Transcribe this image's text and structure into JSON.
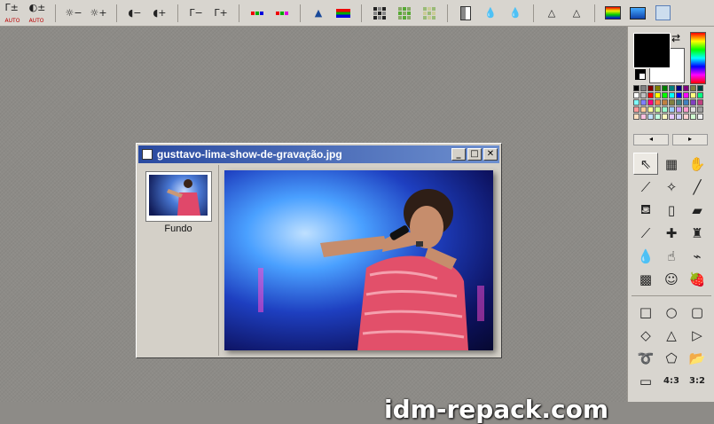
{
  "window": {
    "title": "gusttavo-lima-show-de-gravação.jpg",
    "buttons": {
      "minimize": "_",
      "maximize": "□",
      "close": "✕"
    }
  },
  "layers": [
    {
      "name": "Fundo"
    }
  ],
  "toolbar": {
    "auto_labels": [
      "AUTO",
      "AUTO"
    ],
    "glyphs": {
      "gamma": "Γ±",
      "contrast": "◐±",
      "bright_minus": "☼−",
      "bright_plus": "☼+",
      "half_minus": "◖−",
      "half_plus": "◖+",
      "gamma_minus": "Γ−",
      "gamma_plus": "Γ+",
      "hist": "▲",
      "drop": "💧",
      "tri": "△"
    }
  },
  "palette_nav": {
    "prev": "◂",
    "next": "▸"
  },
  "tool_icons": [
    {
      "name": "selection-arrow-icon",
      "glyph": "⇖"
    },
    {
      "name": "image-select-icon",
      "glyph": "▦"
    },
    {
      "name": "hand-pan-icon",
      "glyph": "✋"
    },
    {
      "name": "eyedropper-icon",
      "glyph": "⟋"
    },
    {
      "name": "magic-wand-icon",
      "glyph": "✧"
    },
    {
      "name": "line-tool-icon",
      "glyph": "╱"
    },
    {
      "name": "fill-bucket-icon",
      "glyph": "⛾"
    },
    {
      "name": "spray-can-icon",
      "glyph": "▯"
    },
    {
      "name": "eraser-icon",
      "glyph": "▰"
    },
    {
      "name": "brush-icon",
      "glyph": "⟋"
    },
    {
      "name": "brush-plus-icon",
      "glyph": "✚"
    },
    {
      "name": "stamp-icon",
      "glyph": "♜"
    },
    {
      "name": "water-drop-icon",
      "glyph": "💧"
    },
    {
      "name": "smudge-icon",
      "glyph": "☝"
    },
    {
      "name": "color-replace-icon",
      "glyph": "⌁"
    },
    {
      "name": "warp-grid-icon",
      "glyph": "▩"
    },
    {
      "name": "portrait-icon",
      "glyph": "☺"
    },
    {
      "name": "strawberry-icon",
      "glyph": "🍓"
    }
  ],
  "shape_icons": [
    {
      "name": "rectangle-icon",
      "glyph": "□"
    },
    {
      "name": "ellipse-icon",
      "glyph": "○"
    },
    {
      "name": "rounded-rectangle-icon",
      "glyph": "▢"
    },
    {
      "name": "diamond-icon",
      "glyph": "◇"
    },
    {
      "name": "triangle-icon",
      "glyph": "△"
    },
    {
      "name": "triangle-right-icon",
      "glyph": "▷"
    },
    {
      "name": "lasso-icon",
      "glyph": "➰"
    },
    {
      "name": "polygon-lasso-icon",
      "glyph": "⬠"
    },
    {
      "name": "open-folder-icon",
      "glyph": "📂"
    },
    {
      "name": "aspect-free-icon",
      "glyph": "▭"
    },
    {
      "name": "aspect-4-3-icon",
      "glyph": "4:3"
    },
    {
      "name": "aspect-3-2-icon",
      "glyph": "3:2"
    }
  ],
  "colors": {
    "foreground": "#000000",
    "background": "#ffffff",
    "palette": [
      "#000000",
      "#7f7f7f",
      "#7f0000",
      "#7f7f00",
      "#007f00",
      "#007f7f",
      "#00007f",
      "#7f007f",
      "#7f7f3f",
      "#003f3f",
      "#ffffff",
      "#c0c0c0",
      "#ff0000",
      "#ffff00",
      "#00ff00",
      "#00ffff",
      "#0000ff",
      "#ff00ff",
      "#ffff7f",
      "#00ff7f",
      "#7fffff",
      "#7f7fff",
      "#ff007f",
      "#ff7f3f",
      "#c08040",
      "#808040",
      "#408080",
      "#4080c0",
      "#8040c0",
      "#c04080",
      "#ff9999",
      "#ffcc99",
      "#ffff99",
      "#ccff99",
      "#99ffcc",
      "#99ccff",
      "#cc99ff",
      "#ff99cc",
      "#e0e0e0",
      "#a0a0a0",
      "#ffe0c0",
      "#ffc0e0",
      "#c0e0ff",
      "#c0ffe0",
      "#fffbc0",
      "#e8c8ff",
      "#d0d0ff",
      "#ffd0d0",
      "#d0ffd0",
      "#f0f0f0"
    ]
  },
  "watermark": "idm-repack.com"
}
